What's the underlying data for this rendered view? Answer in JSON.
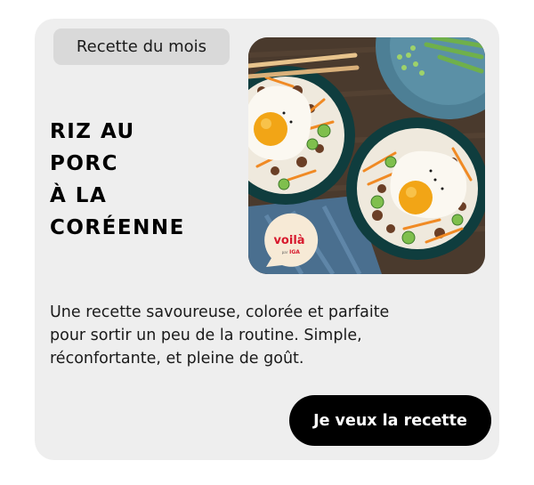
{
  "card": {
    "badge": "Recette du mois",
    "title_lines": [
      "RIZ AU",
      "PORC",
      "À LA",
      "CORÉENNE"
    ],
    "image": {
      "logo_text": "voilà",
      "logo_sub": "par",
      "logo_brand": "IGA"
    },
    "description_lines": [
      "Une recette savoureuse, colorée et parfaite",
      "pour sortir un peu de la routine. Simple,",
      "réconfortante, et pleine de goût."
    ],
    "cta_label": "Je veux la recette"
  },
  "colors": {
    "card_background": "#eeeeee",
    "badge_background": "#d9d9d9",
    "button_background": "#000000",
    "button_text": "#ffffff",
    "brand_red": "#d7192d",
    "bowl_teal": "#0f3d3e"
  }
}
